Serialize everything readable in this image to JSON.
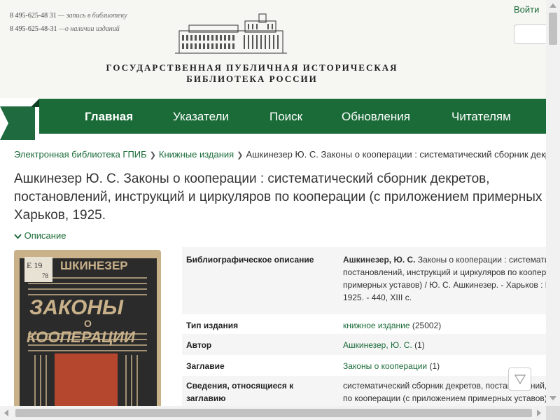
{
  "header": {
    "phone1": "8 495-625-48 31",
    "phone1_note": "— запись в библиотеку",
    "phone2": "8 495-625-48-31",
    "phone2_note": "—о наличии изданий",
    "library_name_line1": "ГОСУДАРСТВЕННАЯ ПУБЛИЧНАЯ ИСТОРИЧЕСКАЯ",
    "library_name_line2": "БИБЛИОТЕКА РОССИИ",
    "login_label": "Войти",
    "search_placeholder": ""
  },
  "nav": {
    "items": [
      {
        "label": "Главная"
      },
      {
        "label": "Указатели"
      },
      {
        "label": "Поиск"
      },
      {
        "label": "Обновления"
      },
      {
        "label": "Читателям"
      }
    ]
  },
  "breadcrumb": {
    "items": [
      {
        "label": "Электронная библиотека ГПИБ"
      },
      {
        "label": "Книжные издания"
      },
      {
        "label": "Ашкинезер Ю. С. Законы о кооперации : систематический сборник декретов, постановлений, инструкций и циркуляров по кооперации"
      }
    ]
  },
  "page": {
    "title_line1": "Ашкинезер Ю. С. Законы о кооперации : систематический сборник декретов,",
    "title_line2": "постановлений, инструкций и циркуляров по кооперации (с приложением примерных уставов).",
    "title_line3": "Харьков, 1925.",
    "description_toggle": "Описание"
  },
  "cover": {
    "stamp_line1": "Е 19",
    "stamp_line2": "78",
    "author_text": "ШКИНЕЗЕР",
    "title_big": "ЗАКОНЫ",
    "title_small": "О",
    "title_line3": "КООПЕРАЦИИ"
  },
  "metadata": {
    "bib_label": "Библиографическое описание",
    "bib_author": "Ашкинезер, Ю. С.",
    "bib_line1": " Законы о кооперации : систематический сборник декретов,",
    "bib_line2": "постановлений, инструкций и циркуляров по кооперации (с приложением",
    "bib_line3": "примерных уставов) / Ю. С. Ашкинезер. - Харьков : Юридическое изд-во,",
    "bib_line4": "1925. - 440, XIII с.",
    "type_label": "Тип издания",
    "type_value": "книжное издание",
    "type_count": " (25002)",
    "author_label": "Автор",
    "author_value": "Ашкинезер, Ю. С.",
    "author_count": " (1)",
    "title_label": "Заглавие",
    "title_value": "Законы о кооперации",
    "title_count": " (1)",
    "info_label_line1": "Сведения, относящиеся к",
    "info_label_line2": "заглавию",
    "info_line1": "систематический сборник декретов, постановлений, инструкций и циркуляров",
    "info_line2": "по кооперации (с приложением примерных уставов)"
  }
}
